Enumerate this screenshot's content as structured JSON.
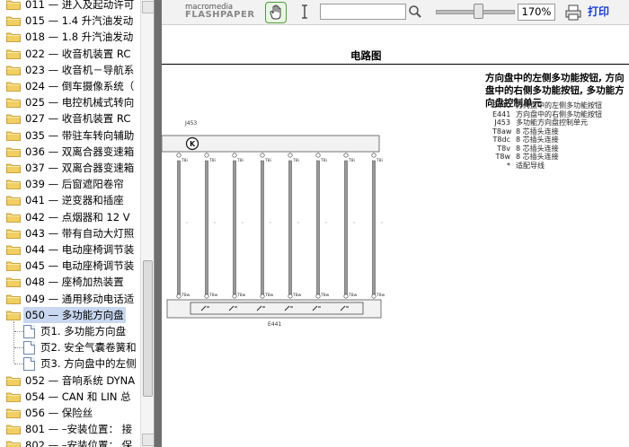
{
  "tree": {
    "items": [
      {
        "label": "011 — 进入及起动许可"
      },
      {
        "label": "015 — 1.4 升汽油发动"
      },
      {
        "label": "018 — 1.8 升汽油发动"
      },
      {
        "label": "022 — 收音机装置 RC"
      },
      {
        "label": "023 — 收音机－导航系"
      },
      {
        "label": "024 — 倒车摄像系统（"
      },
      {
        "label": "025 — 电控机械式转向"
      },
      {
        "label": "027 — 收音机装置 RC"
      },
      {
        "label": "035 — 带驻车转向辅助"
      },
      {
        "label": "036 — 双离合器变速箱"
      },
      {
        "label": "037 — 双离合器变速箱"
      },
      {
        "label": "039 — 后窗遮阳卷帘"
      },
      {
        "label": "041 — 逆变器和插座"
      },
      {
        "label": "042 — 点烟器和 12 V"
      },
      {
        "label": "043 — 带有自动大灯照"
      },
      {
        "label": "044 — 电动座椅调节装"
      },
      {
        "label": "045 — 电动座椅调节装"
      },
      {
        "label": "048 — 座椅加热装置"
      },
      {
        "label": "049 — 通用移动电话适"
      },
      {
        "label": "050 — 多功能方向盘"
      }
    ],
    "pages": [
      {
        "label": "页1. 多功能方向盘"
      },
      {
        "label": "页2. 安全气囊卷簧和"
      },
      {
        "label": "页3. 方向盘中的左侧"
      }
    ],
    "items_after": [
      {
        "label": "052 — 音响系统 DYNA"
      },
      {
        "label": "054 — CAN 和 LIN 总"
      },
      {
        "label": "056 — 保险丝"
      },
      {
        "label": "801 — –安装位置： 接"
      },
      {
        "label": "802 — –安装位置： 保"
      }
    ]
  },
  "toolbar": {
    "brand_top": "macromedia",
    "brand_bottom": "FLASHPAPER",
    "search_value": "",
    "zoom": "170%",
    "zoom_fraction": 0.55,
    "print_label": "打印"
  },
  "document": {
    "title": "电路图",
    "caption": "方向盘中的左侧多功能按钮, 方向盘中的右侧多功能按钮, 多功能方向盘控制单元",
    "legend": [
      {
        "code": "E440",
        "text": "方向盘中的左侧多功能按钮"
      },
      {
        "code": "E441",
        "text": "方向盘中的右侧多功能按钮"
      },
      {
        "code": "J453",
        "text": "多功能方向盘控制单元"
      },
      {
        "code": "T8aw",
        "text": "8 芯插头连接"
      },
      {
        "code": "T8dc",
        "text": "8 芯插头连接"
      },
      {
        "code": "T8v",
        "text": "8 芯插头连接"
      },
      {
        "code": "T8w",
        "text": "8 芯插头连接"
      },
      {
        "code": "*",
        "text": "适配导线"
      }
    ],
    "diagram": {
      "top_component": "J453",
      "bottom_component": "E441",
      "top_pins": [
        "T8i",
        "T8i",
        "T8i",
        "T8i",
        "T8i",
        "T8i",
        "T8i",
        "T8i"
      ],
      "bottom_pins": [
        "T8w",
        "T8w",
        "T8w",
        "T8w",
        "T8w",
        "T8w",
        "T8w",
        "T8w"
      ]
    }
  },
  "colors": {
    "selection": "#c9d7f0",
    "folder": "#f2cf63",
    "print_text": "#1a3fd1",
    "hand_border": "#4f9d3a"
  }
}
